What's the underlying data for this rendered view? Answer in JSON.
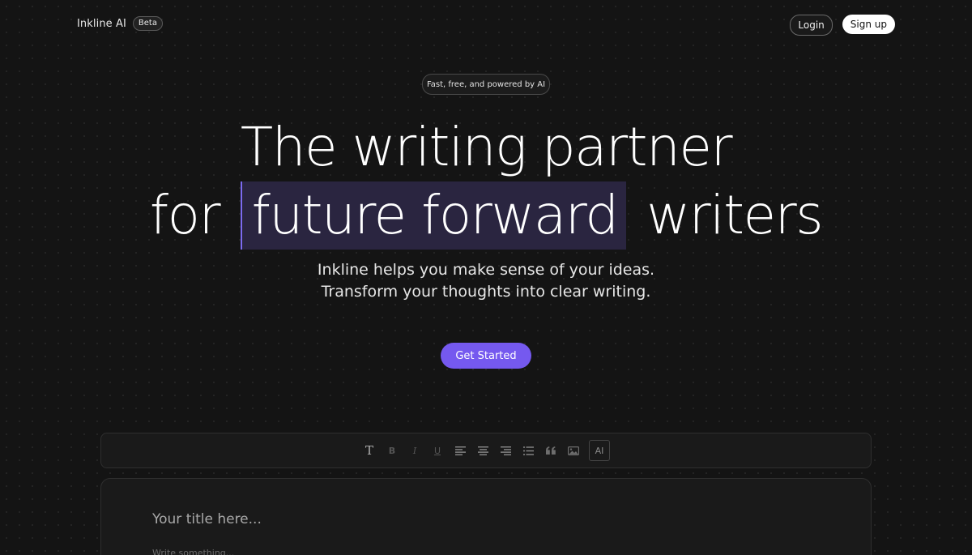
{
  "nav": {
    "brand": "Inkline AI",
    "badge": "Beta",
    "login_label": "Login",
    "signup_label": "Sign up"
  },
  "hero": {
    "tagline": "Fast, free, and powered by AI",
    "headline_line1": "The writing partner",
    "headline_pre": "for",
    "headline_highlight": "future forward",
    "headline_post": "writers",
    "sub_line1": "Inkline helps you make sense of your ideas.",
    "sub_line2": "Transform your thoughts into clear writing.",
    "cta_label": "Get Started"
  },
  "toolbar": {
    "tools": [
      {
        "name": "text-style",
        "glyph": "T"
      },
      {
        "name": "bold",
        "glyph": "B"
      },
      {
        "name": "italic",
        "glyph": "I"
      },
      {
        "name": "underline",
        "glyph": "U"
      },
      {
        "name": "align-left",
        "icon": "align-left-icon"
      },
      {
        "name": "align-center",
        "icon": "align-center-icon"
      },
      {
        "name": "align-right",
        "icon": "align-right-icon"
      },
      {
        "name": "bullet-list",
        "icon": "bullet-list-icon"
      },
      {
        "name": "quote",
        "icon": "quote-icon"
      },
      {
        "name": "image",
        "icon": "image-icon"
      },
      {
        "name": "ai",
        "glyph": "AI"
      }
    ]
  },
  "editor": {
    "title_placeholder": "Your title here...",
    "body_placeholder": "Write something..."
  },
  "colors": {
    "background": "#141414",
    "accent": "#7559ef",
    "highlight_bg": "#2a2540",
    "highlight_border": "#7c6bf0"
  }
}
